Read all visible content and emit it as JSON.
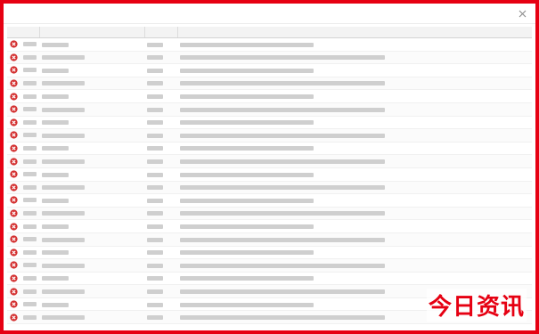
{
  "colors": {
    "frame_border": "#e60012",
    "error_icon": "#d32f2f",
    "watermark": "#e60012"
  },
  "icons": {
    "row_level": "error-icon",
    "window_close": "close-icon"
  },
  "window": {
    "title": ""
  },
  "table": {
    "headers": [
      "",
      "",
      "",
      ""
    ],
    "rows": [
      {
        "level": "",
        "source": "",
        "event": "",
        "desc": ""
      },
      {
        "level": "",
        "source": "",
        "event": "",
        "desc": ""
      },
      {
        "level": "",
        "source": "",
        "event": "",
        "desc": ""
      },
      {
        "level": "",
        "source": "",
        "event": "",
        "desc": ""
      },
      {
        "level": "",
        "source": "",
        "event": "",
        "desc": ""
      },
      {
        "level": "",
        "source": "",
        "event": "",
        "desc": ""
      },
      {
        "level": "",
        "source": "",
        "event": "",
        "desc": ""
      },
      {
        "level": "",
        "source": "",
        "event": "",
        "desc": ""
      },
      {
        "level": "",
        "source": "",
        "event": "",
        "desc": ""
      },
      {
        "level": "",
        "source": "",
        "event": "",
        "desc": ""
      },
      {
        "level": "",
        "source": "",
        "event": "",
        "desc": ""
      },
      {
        "level": "",
        "source": "",
        "event": "",
        "desc": ""
      },
      {
        "level": "",
        "source": "",
        "event": "",
        "desc": ""
      },
      {
        "level": "",
        "source": "",
        "event": "",
        "desc": ""
      },
      {
        "level": "",
        "source": "",
        "event": "",
        "desc": ""
      },
      {
        "level": "",
        "source": "",
        "event": "",
        "desc": ""
      },
      {
        "level": "",
        "source": "",
        "event": "",
        "desc": ""
      },
      {
        "level": "",
        "source": "",
        "event": "",
        "desc": ""
      },
      {
        "level": "",
        "source": "",
        "event": "",
        "desc": ""
      },
      {
        "level": "",
        "source": "",
        "event": "",
        "desc": ""
      },
      {
        "level": "",
        "source": "",
        "event": "",
        "desc": ""
      },
      {
        "level": "",
        "source": "",
        "event": "",
        "desc": ""
      }
    ]
  },
  "watermark": {
    "text": "今日资讯"
  }
}
